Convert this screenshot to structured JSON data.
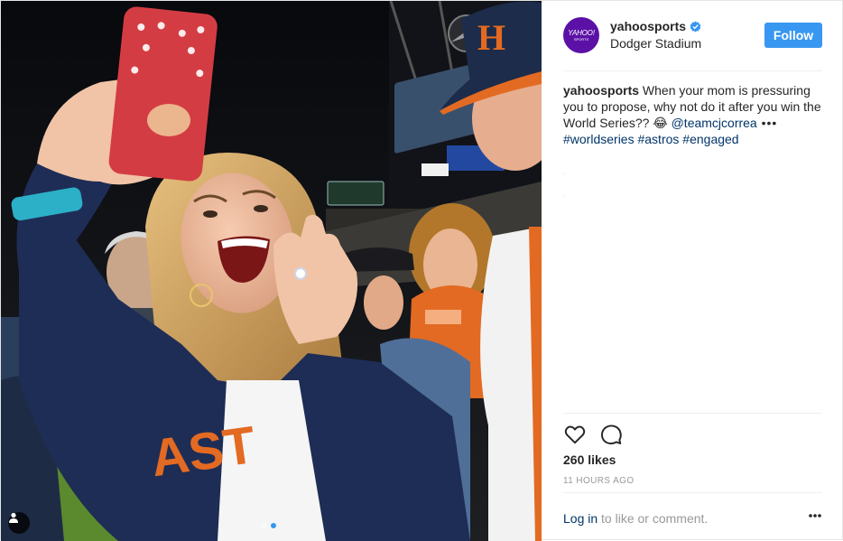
{
  "post": {
    "username": "yahoosports",
    "location": "Dodger Stadium",
    "follow_label": "Follow",
    "avatar_logo": "YAHOO!",
    "avatar_sub": "SPORTS",
    "caption": {
      "author": "yahoosports",
      "text": " When your mom is pressuring you to propose, why not do it after you win the World Series?? 😂 ",
      "mention": "@teamcjcorrea",
      "more": " •••",
      "hashtags": [
        "#worldseries",
        "#astros",
        "#engaged"
      ]
    },
    "likes": "260 likes",
    "timestamp": "11 HOURS AGO",
    "login_link": "Log in",
    "login_rest": " to like or comment."
  },
  "icons": {
    "verified": "verified-badge-icon",
    "like": "heart-icon",
    "comment": "comment-bubble-icon",
    "more": "more-options-icon",
    "tag": "user-tag-icon"
  },
  "colors": {
    "accent": "#3897f0",
    "link": "#003569",
    "avatar_bg": "#5b11a6",
    "muted": "#999999"
  },
  "carousel": {
    "count": 2,
    "active": 2
  }
}
